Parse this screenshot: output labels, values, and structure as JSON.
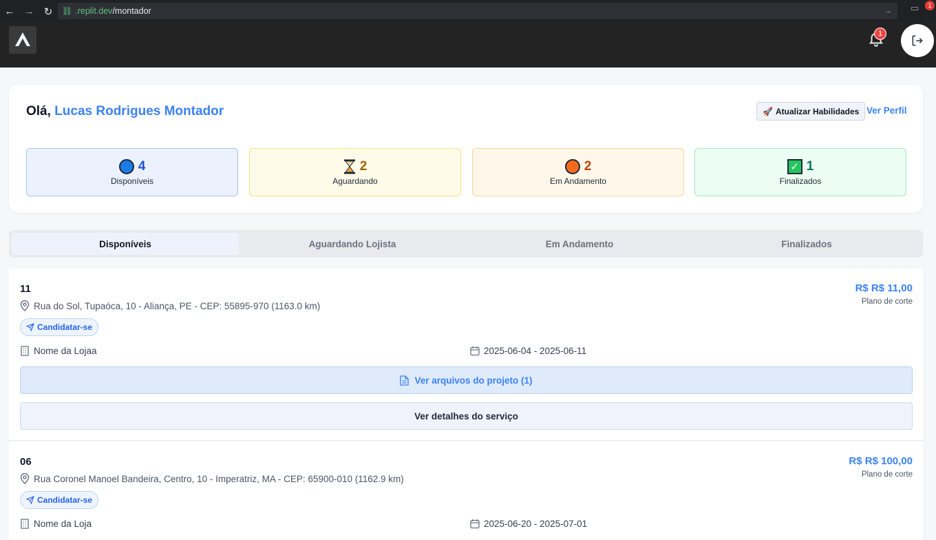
{
  "browser": {
    "url_host": ".replit.dev",
    "url_path": "/montador",
    "ext_badge": "1"
  },
  "header": {
    "notification_count": "1"
  },
  "welcome": {
    "greeting": "Olá,",
    "user_name": "Lucas Rodrigues Montador",
    "skills_button": "Atualizar Habilidades",
    "profile_link": "Ver Perfil"
  },
  "stats": [
    {
      "count": "4",
      "label": "Disponíveis",
      "icon": "blue-circle-icon",
      "color": "#1d4ed8"
    },
    {
      "count": "2",
      "label": "Aguardando",
      "icon": "hourglass-icon",
      "color": "#a16207"
    },
    {
      "count": "2",
      "label": "Em Andamento",
      "icon": "orange-circle-icon",
      "color": "#c2410c"
    },
    {
      "count": "1",
      "label": "Finalizados",
      "icon": "check-mark-icon",
      "color": "#047857"
    }
  ],
  "tabs": [
    {
      "label": "Disponíveis",
      "active": true
    },
    {
      "label": "Aguardando Lojista",
      "active": false
    },
    {
      "label": "Em Andamento",
      "active": false
    },
    {
      "label": "Finalizados",
      "active": false
    }
  ],
  "services": [
    {
      "title": "11",
      "address": "Rua do Sol, Tupaóca, 10 - Aliança, PE - CEP: 55895-970 (1163.0 km)",
      "price": "R$ R$ 11,00",
      "plan": "Plano de corte",
      "apply_label": "Candidatar-se",
      "store": "Nome da Lojaa",
      "dates": "2025-06-04 - 2025-06-11",
      "files_label": "Ver arquivos do projeto (1)",
      "details_label": "Ver detalhes do serviço"
    },
    {
      "title": "06",
      "address": "Rua Coronel Manoel Bandeira, Centro, 10 - Imperatriz, MA - CEP: 65900-010 (1162.9 km)",
      "price": "R$ R$ 100,00",
      "plan": "Plano de corte",
      "apply_label": "Candidatar-se",
      "store": "Nome da Loja",
      "dates": "2025-06-20 - 2025-07-01"
    }
  ]
}
